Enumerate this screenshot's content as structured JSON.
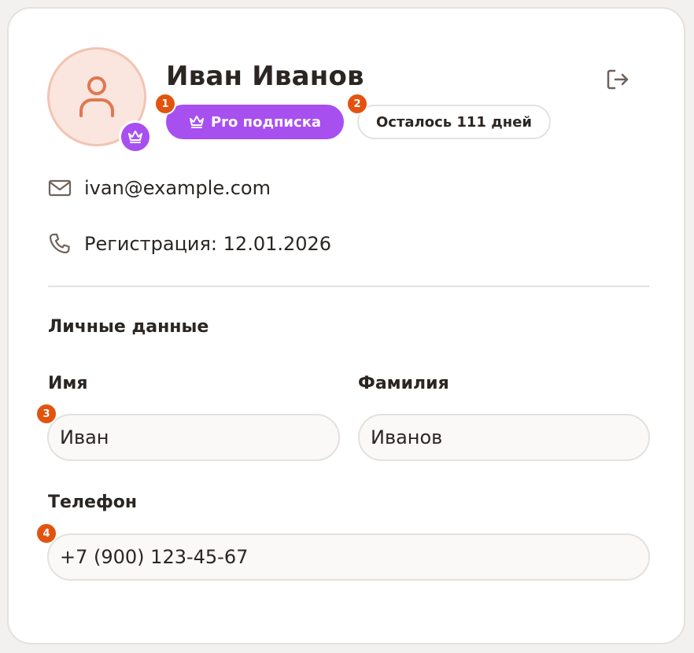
{
  "profile": {
    "name": "Иван Иванов",
    "pro_label": "Pro подписка",
    "days_left": "Осталось 111 дней",
    "email": "ivan@example.com",
    "registration": "Регистрация: 12.01.2026"
  },
  "markers": [
    "1",
    "2",
    "3",
    "4"
  ],
  "personal": {
    "title": "Личные данные",
    "first_name_label": "Имя",
    "first_name_value": "Иван",
    "last_name_label": "Фамилия",
    "last_name_value": "Иванов",
    "phone_label": "Телефон",
    "phone_value": "+7 (900) 123-45-67"
  },
  "icons": {
    "avatar": "person-icon",
    "avatar_badge": "crown-icon",
    "pro": "crown-icon",
    "logout": "logout-icon",
    "email": "mail-icon",
    "registration": "phone-icon"
  },
  "colors": {
    "accent_purple": "#a84ff0",
    "marker_orange": "#e2540e",
    "avatar_bg": "#fbe6df",
    "avatar_ring": "#f1c4b4",
    "avatar_icon": "#e0784f"
  }
}
